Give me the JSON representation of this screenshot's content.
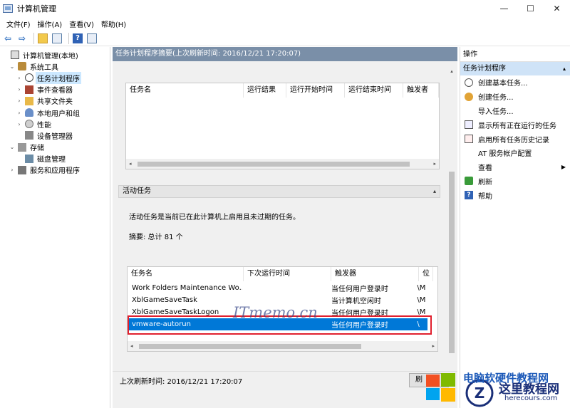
{
  "window": {
    "title": "计算机管理",
    "min": "—",
    "max": "☐",
    "close": "✕"
  },
  "menu": [
    "文件(F)",
    "操作(A)",
    "查看(V)",
    "帮助(H)"
  ],
  "toolbar": {
    "back": "⇦",
    "forward": "⇨",
    "help": "?"
  },
  "tree": [
    {
      "label": "计算机管理(本地)",
      "indent": 0,
      "twisty": "",
      "icon": "computer-icon"
    },
    {
      "label": "系统工具",
      "indent": 1,
      "twisty": "⌄",
      "icon": "tools-icon"
    },
    {
      "label": "任务计划程序",
      "indent": 2,
      "twisty": "›",
      "icon": "clock-icon",
      "selected": true
    },
    {
      "label": "事件查看器",
      "indent": 2,
      "twisty": "›",
      "icon": "event-viewer-icon"
    },
    {
      "label": "共享文件夹",
      "indent": 2,
      "twisty": "›",
      "icon": "shared-folder-icon"
    },
    {
      "label": "本地用户和组",
      "indent": 2,
      "twisty": "›",
      "icon": "users-icon"
    },
    {
      "label": "性能",
      "indent": 2,
      "twisty": "›",
      "icon": "performance-icon"
    },
    {
      "label": "设备管理器",
      "indent": 2,
      "twisty": "",
      "icon": "device-manager-icon"
    },
    {
      "label": "存储",
      "indent": 1,
      "twisty": "⌄",
      "icon": "storage-icon"
    },
    {
      "label": "磁盘管理",
      "indent": 2,
      "twisty": "",
      "icon": "disk-icon"
    },
    {
      "label": "服务和应用程序",
      "indent": 1,
      "twisty": "›",
      "icon": "services-icon"
    }
  ],
  "center": {
    "header": "任务计划程序摘要(上次刷新时间: 2016/12/21 17:20:07)",
    "top_table_headers": [
      "任务名",
      "运行结果",
      "运行开始时间",
      "运行结束时间",
      "触发者"
    ],
    "active_section": "活动任务",
    "collapse_glyph": "▴",
    "description": "活动任务是当前已在此计算机上启用且未过期的任务。",
    "summary": "摘要: 总计 81 个",
    "table_headers": [
      "任务名",
      "下次运行时间",
      "触发器",
      "位"
    ],
    "rows": [
      {
        "name": "Work Folders Maintenance Wo...",
        "next": "",
        "trigger": "当任何用户登录时",
        "loc": "\\M"
      },
      {
        "name": "XblGameSaveTask",
        "next": "",
        "trigger": "当计算机空闲时",
        "loc": "\\M"
      },
      {
        "name": "XblGameSaveTaskLogon",
        "next": "",
        "trigger": "当任何用户登录时",
        "loc": "\\M"
      },
      {
        "name": "vmware-autorun",
        "next": "",
        "trigger": "当任何用户登录时",
        "loc": "\\",
        "selected": true
      }
    ],
    "footer": "上次刷新时间: 2016/12/21 17:20:07",
    "refresh_button": "刷"
  },
  "actions": {
    "title": "操作",
    "section": "任务计划程序",
    "items": [
      {
        "label": "创建基本任务...",
        "icon": "create-basic-task-icon"
      },
      {
        "label": "创建任务...",
        "icon": "create-task-icon"
      },
      {
        "label": "导入任务...",
        "icon": ""
      },
      {
        "label": "显示所有正在运行的任务",
        "icon": "running-tasks-icon"
      },
      {
        "label": "启用所有任务历史记录",
        "icon": "history-icon"
      },
      {
        "label": "AT 服务帐户配置",
        "icon": ""
      },
      {
        "label": "查看",
        "icon": "",
        "submenu": true
      },
      {
        "label": "刷新",
        "icon": "refresh-icon"
      },
      {
        "label": "帮助",
        "icon": "help-icon"
      }
    ]
  },
  "watermark": "ITmemo.cn",
  "logo": {
    "line1": "电脑软硬件教程网",
    "line2": "这里教程网",
    "line3": "herecours.com"
  }
}
